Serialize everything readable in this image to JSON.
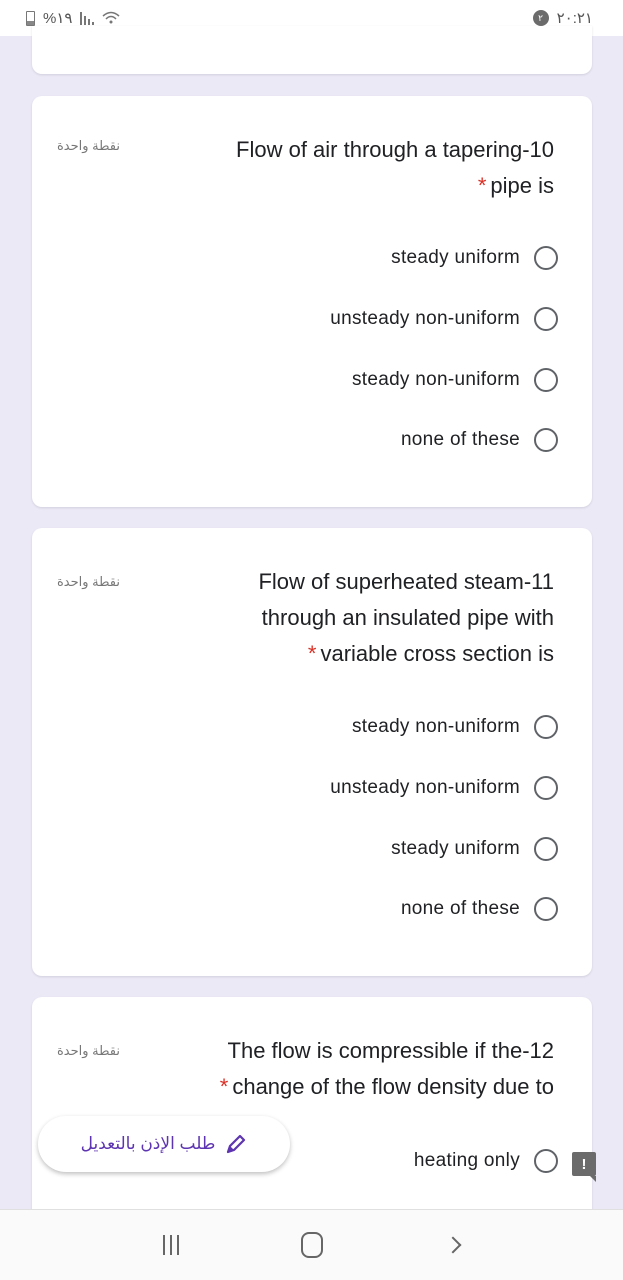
{
  "status_bar": {
    "battery": "%١٩",
    "time": "٢٠:٢١",
    "notification_badge": "٢"
  },
  "questions": [
    {
      "number": "10",
      "points": "نقطة واحدة",
      "title_lines": [
        "Flow of air through a tapering-10",
        "pipe is"
      ],
      "required": "*",
      "options": [
        "steady uniform",
        "unsteady non-uniform",
        "steady non-uniform",
        "none of these"
      ]
    },
    {
      "number": "11",
      "points": "نقطة واحدة",
      "title_lines": [
        "Flow of superheated steam-11",
        "through an insulated pipe with",
        "variable cross section is"
      ],
      "required": "*",
      "options": [
        "steady non-uniform",
        "unsteady non-uniform",
        "steady uniform",
        "none of these"
      ]
    },
    {
      "number": "12",
      "points": "نقطة واحدة",
      "title_lines": [
        "The flow is compressible if the-12",
        "change of the flow density due to"
      ],
      "required": "*",
      "options": [
        "heating only"
      ]
    }
  ],
  "edit_chip": {
    "label": "طلب الإذن بالتعديل",
    "icon": "pencil-icon",
    "color": "#5e35b1"
  },
  "feedback_icon": {
    "label": "!"
  },
  "colors": {
    "background": "#ece9f6",
    "required": "#d93025",
    "accent": "#5e35b1"
  }
}
